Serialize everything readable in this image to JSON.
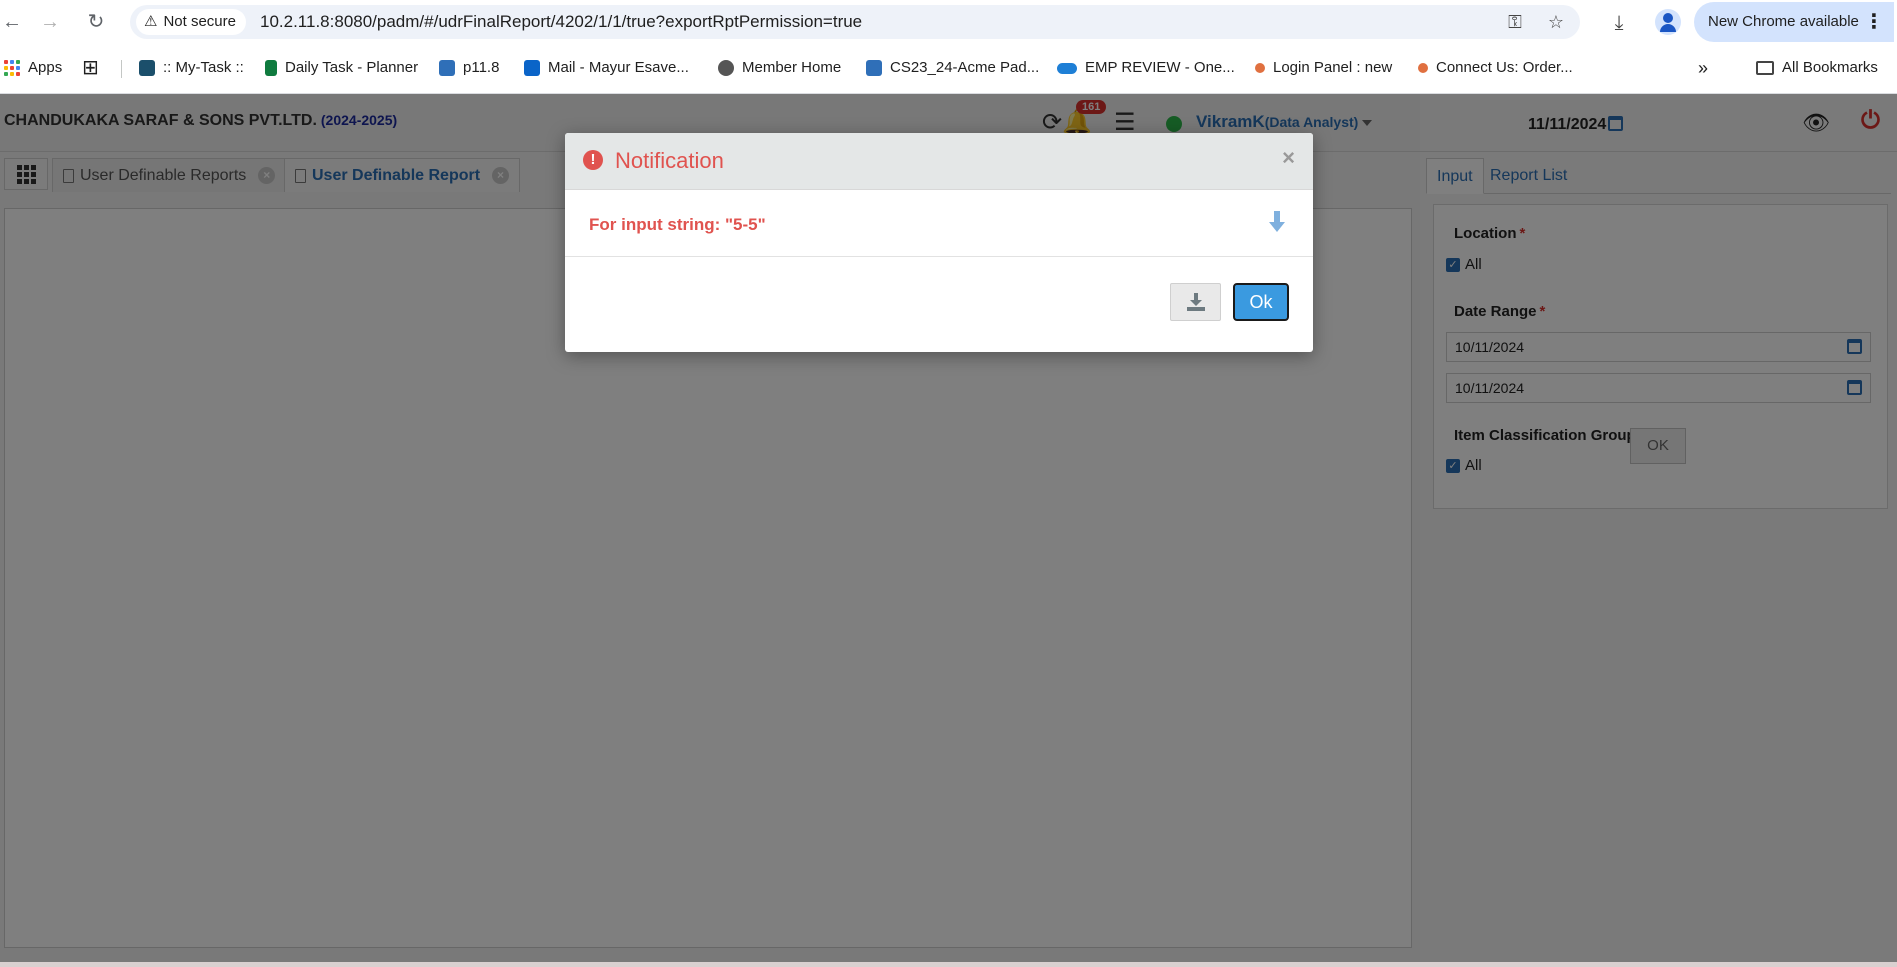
{
  "browser": {
    "security_label": "Not secure",
    "url": "10.2.11.8:8080/padm/#/udrFinalReport/4202/1/1/true?exportRptPermission=true",
    "update_label": "New Chrome available"
  },
  "bookmarks": {
    "apps_label": "Apps",
    "items": [
      {
        "label": ":: My-Task ::",
        "color": "#1b4f6b"
      },
      {
        "label": "Daily Task - Planner",
        "color": "#0f7b3f"
      },
      {
        "label": "p11.8",
        "color": "#2f6fb8"
      },
      {
        "label": "Mail - Mayur Esave...",
        "color": "#0a64c8"
      },
      {
        "label": "Member Home",
        "color": "#555555"
      },
      {
        "label": "CS23_24-Acme Pad...",
        "color": "#2f6fb8"
      },
      {
        "label": "EMP REVIEW - One...",
        "color": "#1e7fd6"
      },
      {
        "label": "Login Panel : new",
        "color": "#e07040"
      },
      {
        "label": "Connect Us: Order...",
        "color": "#e07040"
      }
    ],
    "overflow_label": "»",
    "all_bookmarks_label": "All Bookmarks"
  },
  "app": {
    "company_name": "CHANDUKAKA SARAF & SONS PVT.LTD.",
    "fiscal_year": "(2024-2025)",
    "notification_count": "161",
    "user_name": "VikramK",
    "user_role": "(Data Analyst)",
    "current_date": "11/11/2024",
    "tabs": [
      {
        "label": "User Definable Reports"
      },
      {
        "label": "User Definable Report"
      }
    ]
  },
  "panel": {
    "tabs": [
      {
        "label": "Input"
      },
      {
        "label": "Report List"
      }
    ],
    "location_label": "Location",
    "location_all_label": "All",
    "date_range_label": "Date Range",
    "date_from": "10/11/2024",
    "date_to": "10/11/2024",
    "item_group_label": "Item Classification Group",
    "item_group_all_label": "All",
    "ok_label": "OK",
    "required_mark": "*"
  },
  "modal": {
    "title": "Notification",
    "message": "For input string: \"5-5\"",
    "close_label": "×",
    "ok_label": "Ok"
  },
  "colors": {
    "accent": "#2a6fb5",
    "error": "#e0534f",
    "ok_button": "#3a9ae0"
  }
}
